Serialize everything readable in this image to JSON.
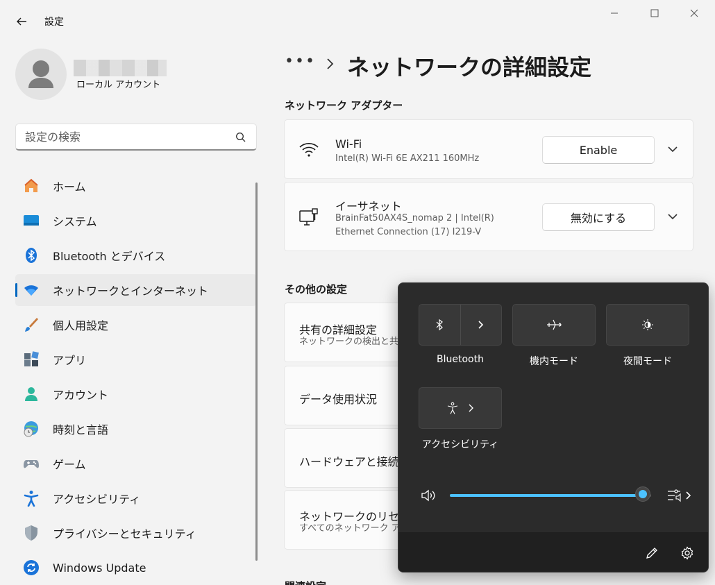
{
  "window": {
    "title": "設定",
    "back_icon": "back-arrow-icon",
    "controls": [
      "minimize-icon",
      "maximize-icon",
      "close-icon"
    ]
  },
  "profile": {
    "account_type": "ローカル アカウント"
  },
  "search": {
    "placeholder": "設定の検索"
  },
  "sidebar": {
    "items": [
      {
        "label": "ホーム",
        "icon": "home-icon"
      },
      {
        "label": "システム",
        "icon": "system-icon"
      },
      {
        "label": "Bluetooth とデバイス",
        "icon": "bluetooth-icon"
      },
      {
        "label": "ネットワークとインターネット",
        "icon": "wifi-icon",
        "active": true
      },
      {
        "label": "個人用設定",
        "icon": "brush-icon"
      },
      {
        "label": "アプリ",
        "icon": "apps-icon"
      },
      {
        "label": "アカウント",
        "icon": "account-icon"
      },
      {
        "label": "時刻と言語",
        "icon": "globe-clock-icon"
      },
      {
        "label": "ゲーム",
        "icon": "gamepad-icon"
      },
      {
        "label": "アクセシビリティ",
        "icon": "accessibility-icon"
      },
      {
        "label": "プライバシーとセキュリティ",
        "icon": "shield-icon"
      },
      {
        "label": "Windows Update",
        "icon": "update-icon"
      }
    ]
  },
  "header": {
    "breadcrumb_more": "•••",
    "title": "ネットワークの詳細設定"
  },
  "adapters": {
    "section_title": "ネットワーク アダプター",
    "items": [
      {
        "name": "Wi-Fi",
        "description": "Intel(R) Wi-Fi 6E AX211 160MHz",
        "button": "Enable",
        "icon": "wifi-icon"
      },
      {
        "name": "イーサネット",
        "description_line1": "BrainFat50AX4S_nomap 2 | Intel(R)",
        "description_line2": "Ethernet Connection (17) I219-V",
        "button": "無効にする",
        "icon": "ethernet-icon"
      }
    ]
  },
  "more_settings": {
    "section_title": "その他の設定",
    "items": [
      {
        "title": "共有の詳細設定",
        "subtitle": "ネットワークの検出と共有"
      },
      {
        "title": "データ使用状況"
      },
      {
        "title": "ハードウェアと接続のプ"
      },
      {
        "title": "ネットワークのリセット",
        "subtitle": "すべてのネットワーク アダ"
      }
    ],
    "next_section_partial": "関連設定"
  },
  "quick_settings": {
    "tiles": [
      {
        "label": "Bluetooth",
        "icon": "bluetooth-icon"
      },
      {
        "label": "機内モード",
        "icon": "airplane-icon"
      },
      {
        "label": "夜間モード",
        "icon": "night-light-icon"
      },
      {
        "label": "アクセシビリティ",
        "icon": "accessibility-icon"
      }
    ],
    "volume_level": 0.96,
    "colors": {
      "accent": "#4cc2ff",
      "background": "#2b2b2b",
      "tile": "#383838"
    },
    "footer": [
      "edit-icon",
      "settings-gear-icon"
    ]
  }
}
